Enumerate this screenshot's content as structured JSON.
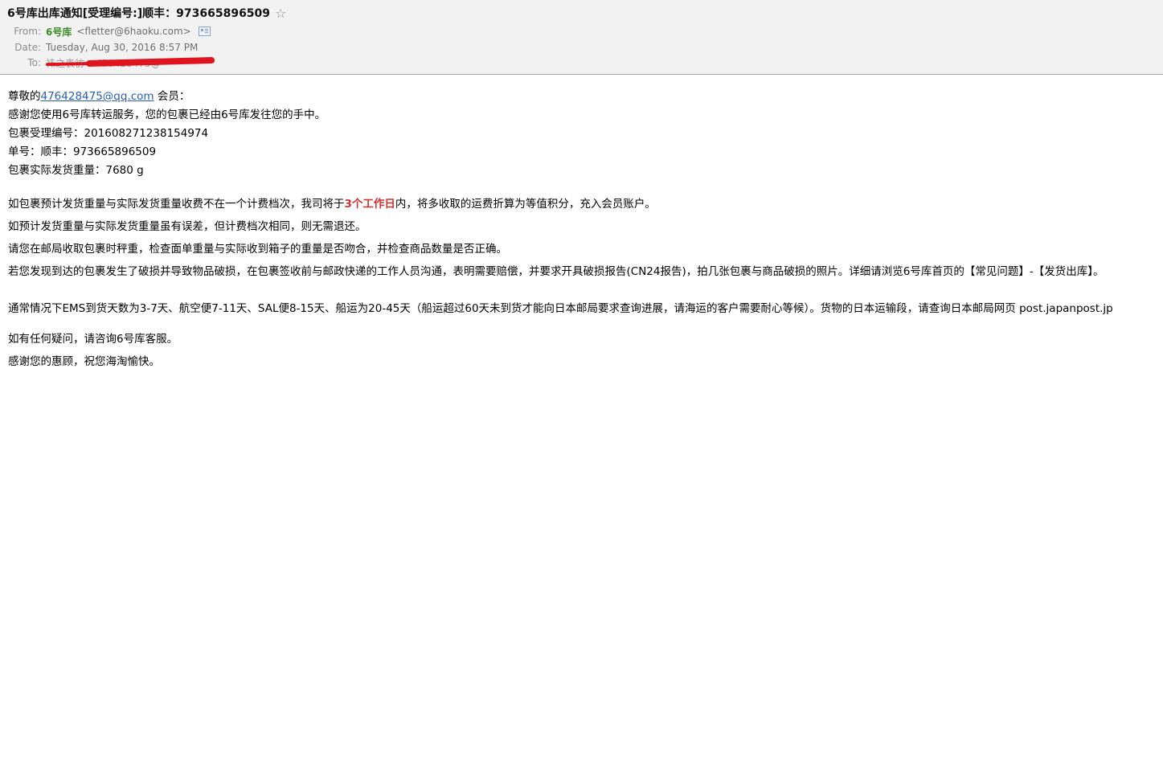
{
  "header": {
    "subject": "6号库出库通知[受理编号:]顺丰：973665896509",
    "star_icon": "star-icon",
    "from_label": "From:",
    "from_name": "6号库",
    "from_email": "<fletter@6haoku.com>",
    "date_label": "Date:",
    "date_value": "Tuesday, Aug 30, 2016 8:57 PM",
    "to_label": "To:",
    "to_value": "祎之表彷 <476428475@"
  },
  "body": {
    "greeting_prefix": "尊敬的",
    "greeting_email": "476428475@qq.com",
    "greeting_suffix": " 会员：",
    "line_thanks": "感谢您使用6号库转运服务，您的包裹已经由6号库发往您的手中。",
    "line_accept": "包裹受理编号：201608271238154974",
    "line_tracking": "单号：顺丰：973665896509",
    "line_weight": "包裹实际发货重量：7680 g",
    "para1_a": "如包裹预计发货重量与实际发货重量收费不在一个计费档次，我司将于",
    "para1_highlight": "3个工作日",
    "para1_b": "内，将多收取的运费折算为等值积分，充入会员账户。",
    "para2": "如预计发货重量与实际发货重量虽有误差，但计费档次相同，则无需退还。",
    "para3": "请您在邮局收取包裹时秤重，检查面单重量与实际收到箱子的重量是否吻合，并检查商品数量是否正确。",
    "para4": "若您发现到达的包裹发生了破损并导致物品破损，在包裹签收前与邮政快递的工作人员沟通，表明需要赔偿，并要求开具破损报告(CN24报告)，拍几张包裹与商品破损的照片。详细请浏览6号库首页的【常见问题】-【发货出库】。",
    "para5": "通常情况下EMS到货天数为3-7天、航空便7-11天、SAL便8-15天、船运为20-45天（船运超过60天未到货才能向日本邮局要求查询进展，请海运的客户需要耐心等候）。货物的日本运输段，请查询日本邮局网页 post.japanpost.jp",
    "para6": "如有任何疑问，请咨询6号库客服。",
    "para7": "感谢您的惠顾，祝您海淘愉快。"
  }
}
